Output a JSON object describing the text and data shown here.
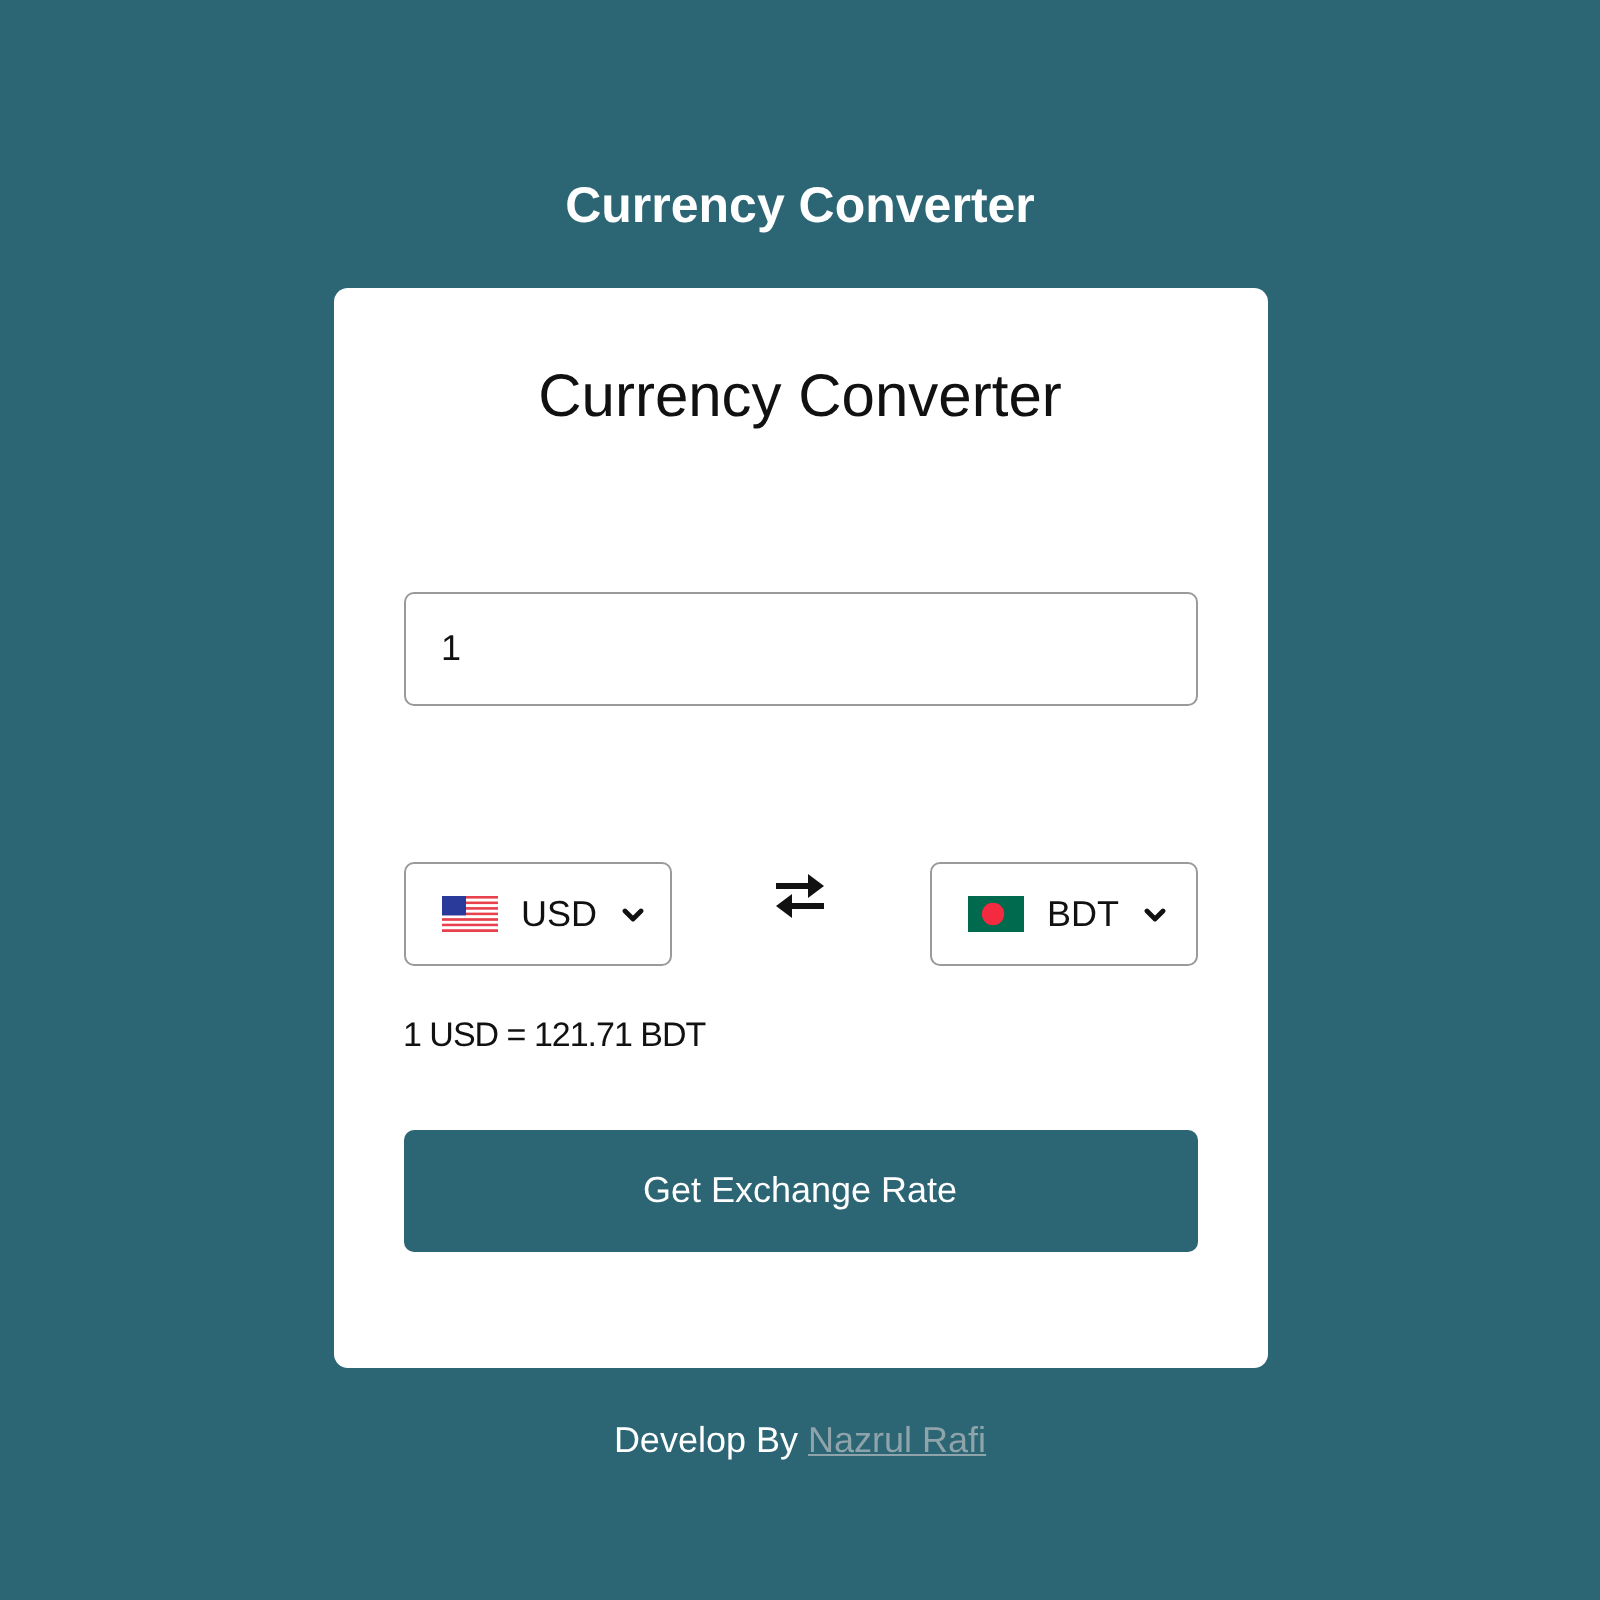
{
  "header": {
    "title": "Currency Converter"
  },
  "card": {
    "title": "Currency Converter",
    "amount": {
      "value": "1"
    },
    "currencies": [
      {
        "code": "USD"
      },
      {
        "code": "BDT"
      }
    ],
    "rate": "1 USD = 121.71 BDT",
    "button": "Get Exchange Rate"
  },
  "footer": {
    "text": "Develop By",
    "link": "Nazrul Rafi"
  }
}
